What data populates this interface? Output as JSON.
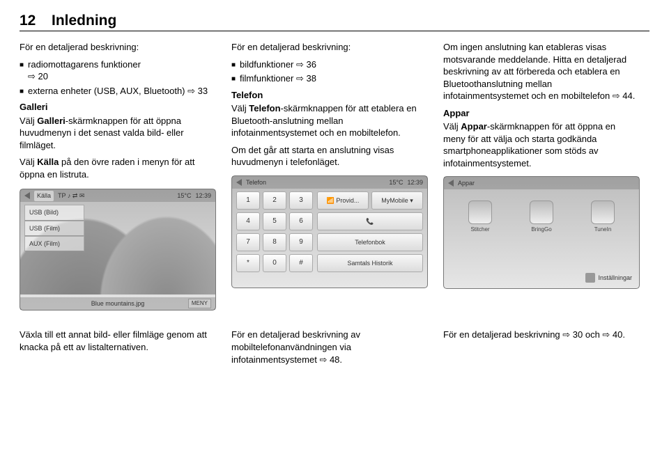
{
  "header": {
    "page_number": "12",
    "title": "Inledning"
  },
  "col1": {
    "intro": "För en detaljerad beskrivning:",
    "bullets": [
      {
        "text": "radiomottagarens funktioner",
        "ref": "⇨ 20"
      },
      {
        "text": "externa enheter (USB, AUX, Bluetooth)",
        "ref": "⇨ 33"
      }
    ],
    "sec_title": "Galleri",
    "p1_a": "Välj ",
    "p1_b": "Galleri",
    "p1_c": "-skärmknappen för att öppna huvudmenyn i det senast valda bild- eller filmläget.",
    "p2_a": "Välj ",
    "p2_b": "Källa",
    "p2_c": " på den övre raden i menyn för att öppna en listruta."
  },
  "col2": {
    "intro": "För en detaljerad beskrivning:",
    "bullets": [
      {
        "text": "bildfunktioner",
        "ref": "⇨ 36"
      },
      {
        "text": "filmfunktioner",
        "ref": "⇨ 38"
      }
    ],
    "sec_title": "Telefon",
    "p1_a": "Välj ",
    "p1_b": "Telefon",
    "p1_c": "-skärmknappen för att etablera en Bluetooth-anslutning mellan infotainmentsystemet och en mobiltelefon.",
    "p2": "Om det går att starta en anslutning visas huvudmenyn i telefonläget."
  },
  "col3": {
    "p1": "Om ingen anslutning kan etableras visas motsvarande meddelande. Hitta en detaljerad beskrivning av att förbereda och etablera en Bluetoothanslutning mellan infotainmentsystemet och en mobiltelefon ⇨ 44.",
    "sec_title": "Appar",
    "p2_a": "Välj ",
    "p2_b": "Appar",
    "p2_c": "-skärmknappen för att öppna en meny för att välja och starta godkända smartphoneapplikationer som stöds av infotainmentsystemet."
  },
  "thumb1": {
    "src_label": "Källa",
    "status_icons": "TP ♪ ⇄ ✉",
    "temp": "15°C",
    "time": "12:39",
    "items": [
      "USB (Bild)",
      "USB (Film)",
      "AUX (Film)"
    ],
    "caption": "Blue mountains.jpg",
    "meny": "MENY"
  },
  "thumb2": {
    "title": "Telefon",
    "temp": "15°C",
    "time": "12:39",
    "keys": [
      "1",
      "2",
      "3",
      "4",
      "5",
      "6",
      "7",
      "8",
      "9",
      "*",
      "0",
      "#"
    ],
    "top_left": "📶 Provid...",
    "top_right": "MyMobile ▾",
    "call": "📞",
    "phonebook": "Telefonbok",
    "history": "Samtals Historik"
  },
  "thumb3": {
    "title": "Appar",
    "apps": [
      "Stitcher",
      "BringGo",
      "TuneIn"
    ],
    "settings": "Inställningar"
  },
  "bottom": {
    "c1": "Växla till ett annat bild- eller filmläge genom att knacka på ett av listalternativen.",
    "c2": "För en detaljerad beskrivning av mobiltelefonanvändningen via infotainmentsystemet ⇨ 48.",
    "c3": "För en detaljerad beskrivning ⇨ 30 och ⇨ 40."
  }
}
